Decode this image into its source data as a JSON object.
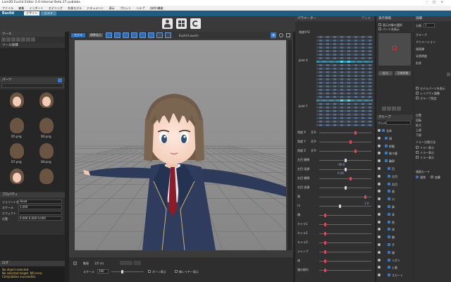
{
  "window": {
    "title": "Live2D Euclid Editor 2.0 Internal Beta 27 publabs",
    "controls": [
      "–",
      "□",
      "×"
    ]
  },
  "menu": [
    "ファイル",
    "編集",
    "インポート",
    "モデリング",
    "外部モデル",
    "ドキュメント",
    "表示",
    "プロット",
    "ヘルプ",
    "(試作)機能"
  ],
  "brand": {
    "name": "Euclid",
    "tabs": [
      "デザイン",
      "ビルド"
    ]
  },
  "toolbar": {
    "icons": [
      "person-icon",
      "grid-icon",
      "refresh-icon"
    ]
  },
  "left": {
    "tool_header": "ツール",
    "tool_sub": "ツール詳細",
    "parts_header": "パーツ",
    "thumbs": [
      {
        "label": "",
        "skin": true
      },
      {
        "label": "",
        "skin": true
      },
      {
        "label": "D5.png",
        "skin": false
      },
      {
        "label": "D6.png",
        "skin": false
      },
      {
        "label": "D7.png",
        "skin": false
      },
      {
        "label": "D8.png",
        "skin": false
      },
      {
        "label": "",
        "skin": true
      },
      {
        "label": "",
        "skin": false
      }
    ],
    "props_header": "プロパティ",
    "props": [
      {
        "label": "ジョイント名",
        "value": "Head"
      },
      {
        "label": "スケール",
        "value": "1.000"
      },
      {
        "label": "エフェクト",
        "value": ""
      },
      {
        "label": "位置",
        "value": "0.000  0.000  0.000"
      }
    ],
    "log_header": "ログ",
    "log_lines": [
      "No object selected.",
      "No selected target. NO error.",
      "Compilation succeeded."
    ]
  },
  "viewport": {
    "mode": "モデル",
    "submode": "標準表示",
    "scale_label": "スケール",
    "scale_value": "100",
    "opacity_label": "1/5 (x)",
    "check_a": "ボーン表示",
    "check_b": "ボーンの表示",
    "check_c": "線レイヤー表示",
    "tool_a": "Euclid Launch",
    "bottom_label": "動画",
    "bottom_num": "1.0"
  },
  "param_panel": {
    "header": "パラメーター",
    "tab": "アニメ",
    "top_label": "角度XYZ",
    "joints": [
      {
        "label": "Joint X"
      },
      {
        "label": "Joint Y"
      }
    ],
    "sliders": [
      {
        "label": "角度 X",
        "sub": "基準",
        "pos": 0.7,
        "red": true
      },
      {
        "label": "角度 Y",
        "sub": "基準",
        "pos": 0.6,
        "red": true
      },
      {
        "label": "角度 Z",
        "sub": "基準",
        "pos": 0.7,
        "red": true
      },
      {
        "label": "左目 開閉",
        "sub": "",
        "pos": 0.5,
        "red": false
      },
      {
        "label": "左目 笑顔",
        "sub": "",
        "pos": 0.5,
        "red": false
      },
      {
        "label": "右目 開閉",
        "sub": "",
        "pos": 0.6,
        "red": true
      },
      {
        "label": "右目 笑顔",
        "sub": "",
        "pos": 0.5,
        "red": false
      },
      {
        "label": "眉",
        "sub": "",
        "pos": 0.9,
        "red": true
      },
      {
        "label": "口",
        "sub": "",
        "pos": 0.4,
        "red": false
      },
      {
        "label": "頬",
        "sub": "",
        "pos": 0.1,
        "red": true
      },
      {
        "label": "キャラ1",
        "sub": "",
        "pos": 0.1,
        "red": true
      },
      {
        "label": "キャラ2",
        "sub": "",
        "pos": 0.1,
        "red": true
      },
      {
        "label": "キャラ3",
        "sub": "",
        "pos": 0.1,
        "red": true
      },
      {
        "label": "ジャンプ",
        "sub": "",
        "pos": 0.1,
        "red": true
      },
      {
        "label": "体",
        "sub": "",
        "pos": 0.1,
        "red": true
      },
      {
        "label": "服の揺れ",
        "sub": "",
        "pos": 0.1,
        "red": true
      }
    ],
    "mid_value": "-90.0",
    "mid_value2": "0.00",
    "end_value": "1.0"
  },
  "display": {
    "header": "表示領域",
    "items": [
      "表示対象の選択",
      "パーツ名表示"
    ],
    "btn_a": "拡大",
    "btn_b": "可視状態"
  },
  "group": {
    "header": "グループ",
    "filter": "フィルタ",
    "search": "",
    "items": [
      "全体",
      "顔",
      "前髪",
      "後ろ髪",
      "輪郭",
      "目",
      "左目",
      "右目",
      "眉",
      "口",
      "鼻",
      "耳",
      "首",
      "体",
      "腕",
      "手",
      "服",
      "リボン",
      "上着",
      "スカート"
    ]
  },
  "detail": {
    "header": "詳細",
    "mesh_label": "分割",
    "mesh_value": "1",
    "rows": [
      "グループ",
      "アニメーション",
      "描画順",
      "半透明度",
      "形状"
    ],
    "list": [
      "モデルパーツを表示",
      "レイアウト調整",
      "グループ設定"
    ],
    "extra": [
      "位置",
      "回転",
      "拡大",
      "上部",
      "下部"
    ],
    "mirror_label": "ミラー分割方法",
    "mirror_opts": [
      "ミラー表示",
      "ミラー表示",
      "ミラー表示"
    ],
    "radio_label": "描画モード",
    "radios": [
      "通常",
      "加算"
    ]
  }
}
